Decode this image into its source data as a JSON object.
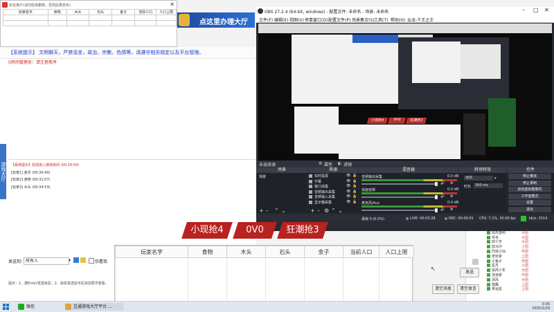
{
  "colors": {
    "accent_blue": "#2a5fc2",
    "obs_bg": "#272a33",
    "red_tab": "#b8221f",
    "live_green": "#2cc12c"
  },
  "chat": {
    "notice": "【系统提示】 文明聊天，严禁谣言，政治、宗教、色情等，请遵守相关规定以及平台管理。",
    "admin_line": "0房间管理员：请注意秩序",
    "side_tab": "游戏大厅",
    "messages": [
      "【系统提示】欢迎进入游戏房间 (00:29:09)",
      "[玩家1] 金币 (00:30:40)",
      "[玩家2] 食物 (00:31:07)",
      "[玩家3] 木头 (00:34:53)"
    ],
    "send_label": "发送到：",
    "send_target": "所有人",
    "only_host": "仅看我",
    "hint": "提示：1、按Enter发送消息，2、消息发送后可在消息框中查看。",
    "send_button": "发送",
    "clear_button": "清空消息",
    "close_button": "清空发言"
  },
  "user_list": [
    {
      "name": "方圆",
      "tag": "大团"
    },
    {
      "name": "阳光普照",
      "tag": "大团"
    },
    {
      "name": "毛毛",
      "tag": "大团"
    },
    {
      "name": "四十岁",
      "tag": "大团"
    },
    {
      "name": "双马仔",
      "tag": "上团"
    },
    {
      "name": "烈焰小仙",
      "tag": "中团"
    },
    {
      "name": "老玩家",
      "tag": "上团"
    },
    {
      "name": "小兔子",
      "tag": "中团"
    },
    {
      "name": "星月",
      "tag": "小团"
    },
    {
      "name": "追风少年",
      "tag": "大团"
    },
    {
      "name": "流浪者",
      "tag": "中团"
    },
    {
      "name": "清风",
      "tag": "大团"
    },
    {
      "name": "猎鹰",
      "tag": "上团"
    },
    {
      "name": "幸运星",
      "tag": "上团"
    }
  ],
  "mini_window": {
    "title": "实名用户(请勿轻易删除，否则后果自负)",
    "columns": [
      "玩家名字",
      "食物",
      "木头",
      "石头",
      "金子",
      "当前人口",
      "人口上限"
    ]
  },
  "banner_text": "点这里办理大厅",
  "obs": {
    "title": "OBS 27.2.4 (64-bit, windows) - 配置文件: 未命名 - 场景: 未命名",
    "menu": [
      "文件(F)",
      "编辑(E)",
      "视图(V)",
      "停靠窗口(D)",
      "配置文件(P)",
      "场景集合(S)",
      "工具(T)",
      "帮助(H)",
      "云龙-千王之王"
    ],
    "tabs": [
      "未选择源",
      "属性",
      "滤镜"
    ],
    "docks": [
      "场景",
      "来源",
      "混音器",
      "转场特效",
      "控件"
    ],
    "scenes": [
      "场景"
    ],
    "sources": [
      "实时投屏",
      "字幕",
      "窗口采集",
      "音频输出采集",
      "音频输入采集",
      "显示器采集"
    ],
    "mixer": [
      {
        "name": "音频输出采集",
        "db": "0.0 dB"
      },
      {
        "name": "桌面音频",
        "db": "0.0 dB"
      },
      {
        "name": "麦克风/Aux",
        "db": "0.0 dB"
      }
    ],
    "transition": {
      "type": "淡出",
      "duration_label": "时长",
      "duration": "300 ms"
    },
    "controls": [
      "停止推流",
      "停止录制",
      "启动虚拟摄像机",
      "工作室模式",
      "设置",
      "退出"
    ],
    "status": {
      "dropped": "丢帧 0 (0.0%)",
      "live": "LIVE: 00:03:28",
      "rec": "REC: 00:00:01",
      "cpu": "CPU: 7.1%, 30.00 fps",
      "kbps": "kb/s: 2514"
    },
    "preview_tabs": [
      "小现抢4",
      "0V0",
      "狂潮抢3"
    ]
  },
  "overlay": {
    "tabs": [
      "小现抢4",
      "0V0",
      "狂潮抢3"
    ],
    "columns": [
      "玩家名字",
      "食物",
      "木头",
      "石头",
      "金子",
      "当前人口",
      "人口上限"
    ]
  },
  "taskbar": {
    "apps": [
      {
        "label": "微信",
        "color": "#1aad19"
      },
      {
        "label": "互通游戏大厅平台 ...",
        "color": "#e8a13a"
      }
    ],
    "time": "0:35",
    "date": "2025/1/29"
  }
}
